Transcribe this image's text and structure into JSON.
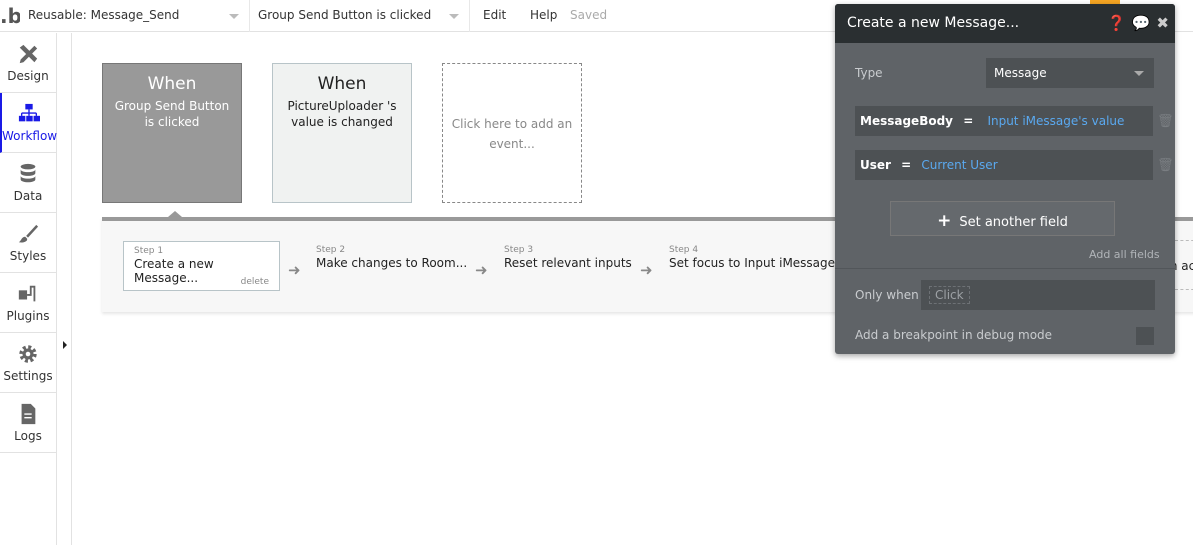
{
  "topbar": {
    "page_selector": "Reusable: Message_Send",
    "event_selector": "Group Send Button is clicked",
    "menu": [
      "Edit",
      "Help"
    ],
    "status": "Saved"
  },
  "sidebar": {
    "items": [
      {
        "label": "Design",
        "icon": "design-icon"
      },
      {
        "label": "Workflow",
        "icon": "workflow-icon",
        "active": true
      },
      {
        "label": "Data",
        "icon": "database-icon"
      },
      {
        "label": "Styles",
        "icon": "brush-icon"
      },
      {
        "label": "Plugins",
        "icon": "plug-icon"
      },
      {
        "label": "Settings",
        "icon": "gear-icon"
      },
      {
        "label": "Logs",
        "icon": "document-icon"
      }
    ]
  },
  "events": [
    {
      "when": "When",
      "text": "Group Send Button is clicked"
    },
    {
      "when": "When",
      "text": "PictureUploader 's value is changed"
    },
    {
      "add": "Click here to add an event..."
    }
  ],
  "steps": [
    {
      "num": "Step 1",
      "label": "Create a new Message...",
      "delete": "delete"
    },
    {
      "num": "Step 2",
      "label": "Make changes to Room..."
    },
    {
      "num": "Step 3",
      "label": "Reset relevant inputs"
    },
    {
      "num": "Step 4",
      "label": "Set focus to Input iMessage"
    }
  ],
  "step_peek": "Click here to add an action...",
  "panel": {
    "title": "Create a new Message...",
    "type_label": "Type",
    "type_value": "Message",
    "fields": [
      {
        "name": "MessageBody",
        "eq": "=",
        "value": "Input iMessage's value"
      },
      {
        "name": "User",
        "eq": "=",
        "value": "Current User"
      }
    ],
    "set_another": "Set another field",
    "add_all": "Add all fields",
    "only_when": "Only when",
    "click_placeholder": "Click",
    "breakpoint": "Add a breakpoint in debug mode"
  },
  "colors": {
    "accent": "#1a1ae6",
    "link": "#5aa9f0",
    "panel_bg": "#5f6367",
    "panel_header": "#2a2f31"
  }
}
